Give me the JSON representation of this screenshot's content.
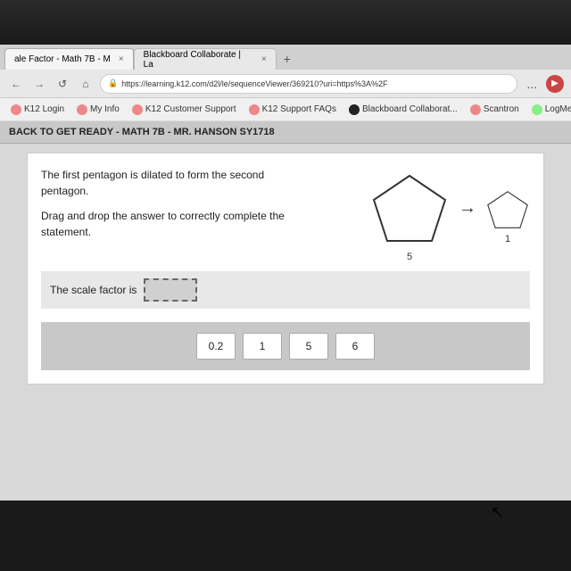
{
  "topbar": {
    "visible": true
  },
  "browser": {
    "tabs": [
      {
        "label": "ale Factor - Math 7B - M",
        "active": true,
        "close": "×"
      },
      {
        "label": "Blackboard Collaborate | La",
        "active": false,
        "close": "×"
      }
    ],
    "new_tab_label": "+",
    "url": "https://learning.k12.com/d2l/le/sequenceViewer/369210?uri=https%3A%2F",
    "url_icon": "🔒",
    "back_btn": "←",
    "forward_btn": "→",
    "refresh_btn": "↺",
    "home_btn": "⌂",
    "more_btn": "..."
  },
  "bookmarks": [
    {
      "label": "K12 Login",
      "color": "red"
    },
    {
      "label": "My Info",
      "color": "red"
    },
    {
      "label": "K12 Customer Support",
      "color": "red"
    },
    {
      "label": "K12 Support FAQs",
      "color": "red"
    },
    {
      "label": "Blackboard Collaborat...",
      "color": "black"
    },
    {
      "label": "Scantron",
      "color": "red"
    },
    {
      "label": "LogMe",
      "color": "red"
    }
  ],
  "page": {
    "header": "BACK TO GET READY - MATH 7B - MR. HANSON SY1718",
    "question_line1": "The first pentagon is dilated to form the second",
    "question_line2": "pentagon.",
    "instruction_line1": "Drag and drop the answer to correctly complete the",
    "instruction_line2": "statement.",
    "scale_factor_label": "The scale factor is",
    "large_pentagon_label": "5",
    "small_pentagon_label": "1",
    "arrow": "→",
    "choices": [
      "0.2",
      "1",
      "5",
      "6"
    ]
  }
}
